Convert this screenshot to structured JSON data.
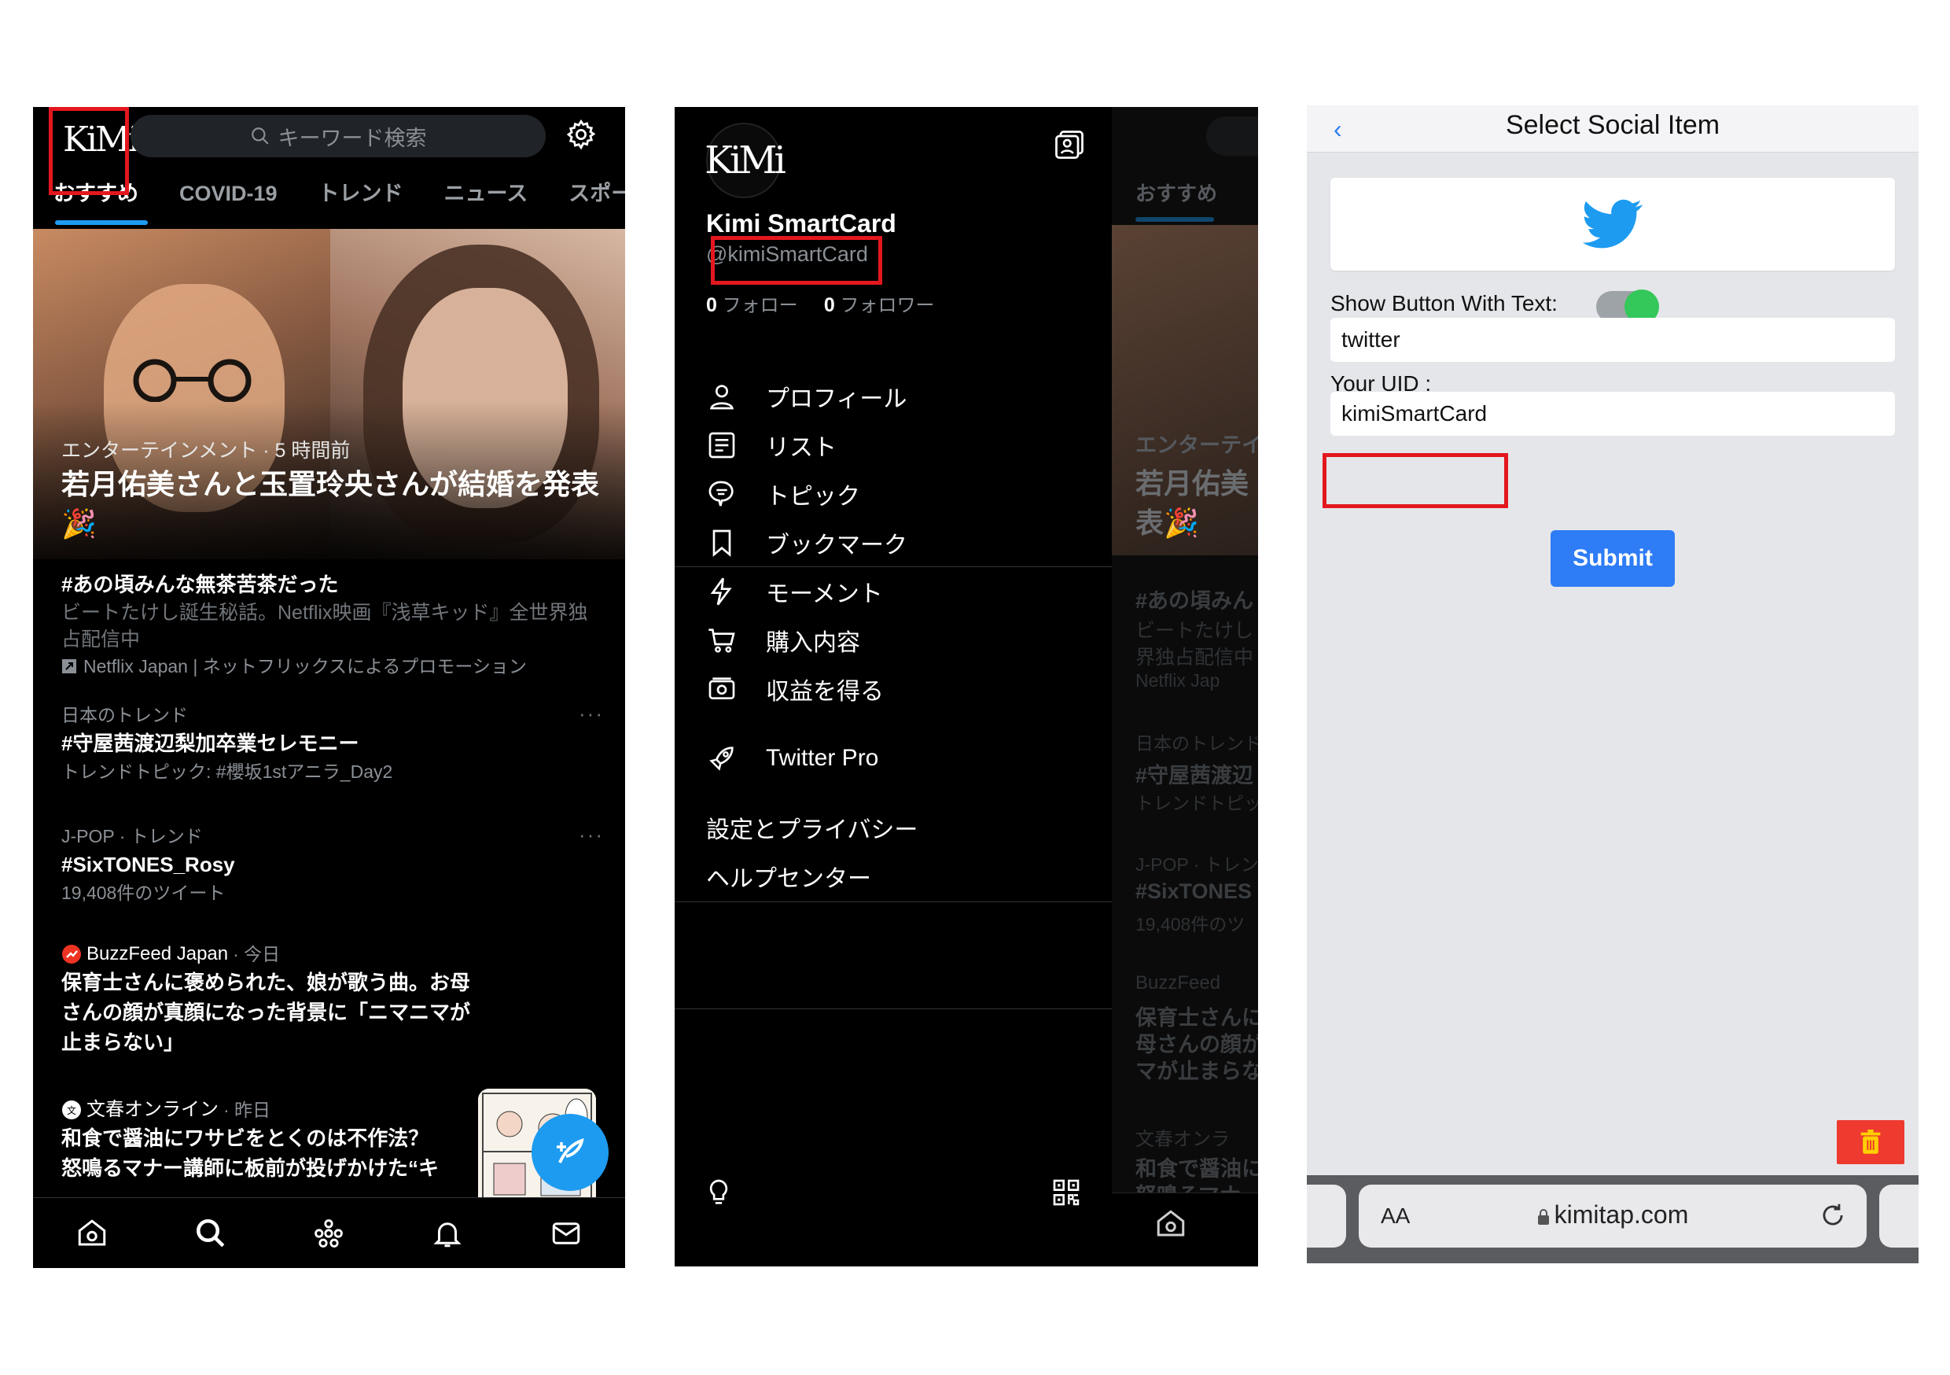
{
  "panel1": {
    "logo": "KiMi",
    "search_placeholder": "キーワード検索",
    "tabs": [
      "おすすめ",
      "COVID-19",
      "トレンド",
      "ニュース",
      "スポーツ"
    ],
    "hero": {
      "meta": "エンターテインメント · 5 時間前",
      "title": "若月佑美さんと玉置玲央さんが結婚を発表🎉"
    },
    "items": [
      {
        "title": "#あの頃みんな無茶苦茶だった",
        "desc": "ビートたけし誕生秘話。Netflix映画『浅草キッド』全世界独占配信中",
        "promo": "Netflix Japan | ネットフリックスによるプロモーション"
      },
      {
        "context": "日本のトレンド",
        "title": "#守屋茜渡辺梨加卒業セレモニー",
        "sub": "トレンドトピック: #櫻坂1stアニラ_Day2"
      },
      {
        "context": "J-POP · トレンド",
        "title": "#SixTONES_Rosy",
        "sub": "19,408件のツイート"
      },
      {
        "source": "BuzzFeed Japan",
        "time": "· 今日",
        "title": "保育士さんに褒められた、娘が歌う曲。お母さんの顔が真顔になった背景に「ニマニマが止まらない」"
      },
      {
        "source": "文春オンライン",
        "time": "· 昨日",
        "title": "和食で醤油にワサビをとくのは不作法？",
        "title2": "怒鳴るマナー講師に板前が投げかけた“キ"
      }
    ],
    "more": "···"
  },
  "panel2": {
    "avatar_text": "KiMi",
    "name": "Kimi SmartCard",
    "handle": "@kimiSmartCard",
    "following_count": "0",
    "following_label": "フォロー",
    "followers_count": "0",
    "followers_label": "フォロワー",
    "menu": [
      "プロフィール",
      "リスト",
      "トピック",
      "ブックマーク",
      "モーメント",
      "購入内容",
      "収益を得る"
    ],
    "pro": "Twitter Pro",
    "settings": "設定とプライバシー",
    "help": "ヘルプセンター",
    "under": {
      "tab": "おすすめ",
      "lines": [
        "エンターテイ",
        "若月佑美",
        "表🎉",
        "#あの頃みん",
        "ビートたけし",
        "界独占配信中",
        "Netflix Jap",
        "日本のトレンド",
        "#守屋茜渡辺",
        "トレンドトピッ",
        "J-POP · トレン",
        "#SixTONES",
        "19,408件のツ",
        "BuzzFeed",
        "保育士さんに",
        "母さんの顔が",
        "マが止まらな",
        "文春オンラ",
        "和食で醤油に",
        "怒鳴るマナー"
      ]
    }
  },
  "panel3": {
    "title": "Select Social Item",
    "back": "‹",
    "show_text_label": "Show Button With Text:",
    "button_text_value": "twitter",
    "uid_label": "Your UID :",
    "uid_value": "kimiSmartCard",
    "submit": "Submit",
    "url": "kimitap.com",
    "aa": "AA",
    "toggle_on": true,
    "colors": {
      "twitter": "#1d9bf0",
      "submit": "#2e7cf6",
      "toggle": "#34c759",
      "trash": "#ee3a2f"
    }
  },
  "colors": {
    "highlight": "#e3171e",
    "accent": "#1d9bf0"
  }
}
